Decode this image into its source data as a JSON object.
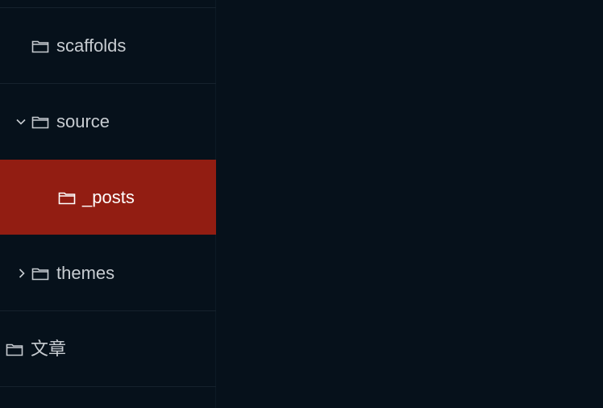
{
  "sidebar": {
    "items": [
      {
        "label": "scaffolds",
        "icon": "folder-icon",
        "expander": "none",
        "selected": false
      },
      {
        "label": "source",
        "icon": "folder-icon",
        "expander": "chevron-down-icon",
        "selected": false
      },
      {
        "label": "_posts",
        "icon": "folder-icon",
        "expander": "none",
        "selected": true
      },
      {
        "label": "themes",
        "icon": "folder-icon",
        "expander": "chevron-right-icon",
        "selected": false
      },
      {
        "label": "文章",
        "icon": "folder-icon",
        "expander": "none",
        "selected": false
      }
    ]
  },
  "colors": {
    "background": "#06111b",
    "selected_background": "#921d12",
    "text": "#c7ccd1",
    "selected_text": "#ffffff",
    "divider": "#16222d"
  }
}
